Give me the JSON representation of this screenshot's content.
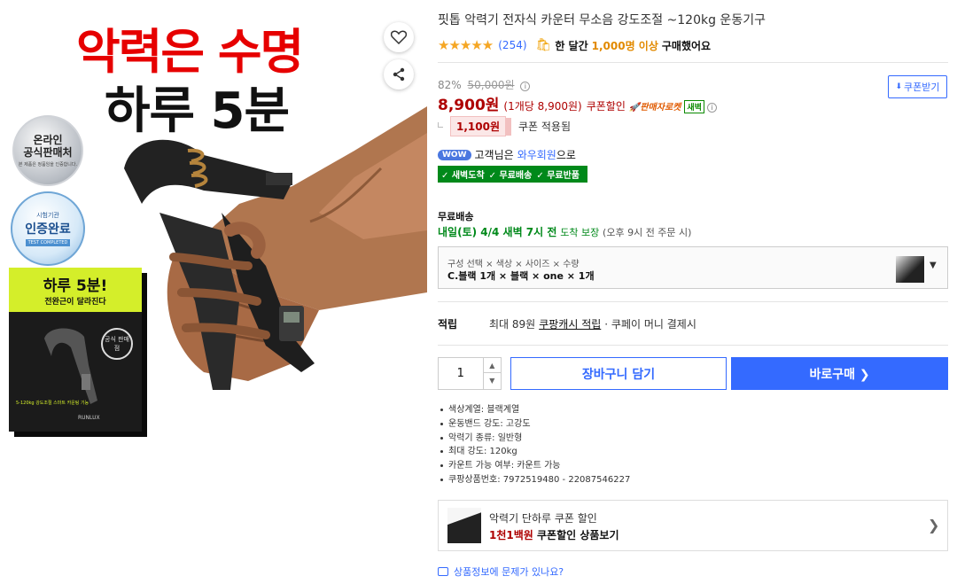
{
  "hero": {
    "headline_red": "악력은 수명",
    "headline_black": "하루 5분",
    "badge_official_line1": "온라인",
    "badge_official_line2": "공식판매처",
    "badge_official_small": "본 제품은 정품임을 인증합니다.",
    "badge_cert_top": "시험기관",
    "badge_cert_main": "인증완료",
    "badge_cert_ribbon": "TEST COMPLETED",
    "box_headline": "하루 5분!",
    "box_sub": "전완근이 달라진다",
    "box_seal": "공식 판매점",
    "box_foot": "5-120kg 강도조절 스마트 카운팅 기능",
    "box_brand": "RUNLUX"
  },
  "icons": {
    "heart": "heart-icon",
    "share": "share-icon"
  },
  "product": {
    "title": "핏톱 악력기 전자식 카운터 무소음 강도조절 ~120kg 운동기구",
    "stars": "★★★★★",
    "review_count": "(254)",
    "sold_prefix": "한 달간",
    "sold_highlight": "1,000명 이상",
    "sold_suffix": "구매했어요",
    "discount_rate": "82%",
    "original_price": "50,000원",
    "price": "8,900원",
    "unit_price": "(1개당 8,900원)",
    "coupon_discount_label": "쿠폰할인",
    "seller_rocket": "판매자로켓",
    "dawn_badge": "새벽",
    "coupon_button": "쿠폰받기",
    "coupon_amount": "1,100원",
    "coupon_applied": "쿠폰 적용됨",
    "wow_badge": "WOW",
    "wow_text_prefix": "고객님은",
    "wow_link": "와우회원",
    "wow_text_suffix": "으로",
    "benefits": [
      "✓ 새벽도착",
      "✓ 무료배송",
      "✓ 무료반품"
    ],
    "shipping_title": "무료배송",
    "shipping_date": "내일(토) 4/4 새벽 7시 전",
    "shipping_guarantee": "도착 보장",
    "shipping_cutoff": "(오후 9시 전 주문 시)",
    "option_label": "구성 선택 × 색상 × 사이즈 × 수량",
    "option_value": "C.블랙 1개 × 블랙 × one × 1개",
    "reward_label": "적립",
    "reward_text": "최대 89원",
    "reward_link": "쿠팡캐시 적립",
    "reward_tail": "· 쿠페이 머니 결제시",
    "quantity": "1",
    "cart_button": "장바구니 담기",
    "buy_button": "바로구매 ❯",
    "specs": [
      "색상계열: 블랙계열",
      "운동밴드 강도: 고강도",
      "악력기 종류: 일반형",
      "최대 강도: 120kg",
      "카운트 가능 여부: 카운트 가능",
      "쿠팡상품번호: 7972519480 - 22087546227"
    ],
    "promo_title": "악력기 단하루 쿠폰 할인",
    "promo_highlight": "1천1백원",
    "promo_tail": "쿠폰할인 상품보기",
    "report_link": "상품정보에 문제가 있나요?"
  },
  "colors": {
    "accent_blue": "#346aff",
    "price_red": "#ae0000",
    "rocket_green": "#00891a",
    "hero_red": "#e60000"
  }
}
